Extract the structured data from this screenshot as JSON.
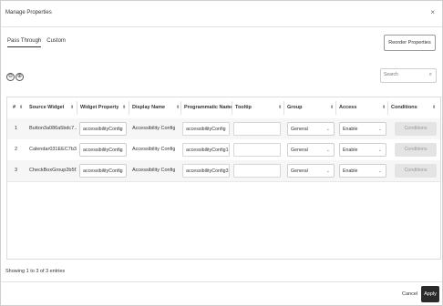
{
  "dialog": {
    "title": "Manage Properties",
    "close_icon": "×"
  },
  "tabs": [
    {
      "label": "Pass Through",
      "active": true
    },
    {
      "label": "Custom",
      "active": false
    }
  ],
  "toolbar": {
    "reorder_label": "Reorder Properties",
    "collapse_glyph": "⊖",
    "expand_glyph": "⊕"
  },
  "search": {
    "placeholder": "Search",
    "value": ""
  },
  "table": {
    "headers": {
      "index": "#",
      "source_widget": "Source Widget",
      "widget_property": "Widget Property",
      "display_name": "Display Name",
      "programmatic_name": "Programmatic Name",
      "tooltip": "Tooltip",
      "group": "Group",
      "access": "Access",
      "conditions": "Conditions"
    },
    "rows": [
      {
        "index": "1",
        "source_widget": "Button3a086a5bdc7...",
        "widget_property": "accessibilityConfig",
        "display_name": "Accessibility Config",
        "programmatic_name": "accessibilityConfig",
        "tooltip": "",
        "group": "General",
        "access": "Enable",
        "conditions": "Conditions"
      },
      {
        "index": "2",
        "source_widget": "Calendar031EEC7b3...",
        "widget_property": "accessibilityConfig",
        "display_name": "Accessibility Config",
        "programmatic_name": "accessibilityConfig1",
        "tooltip": "",
        "group": "General",
        "access": "Enable",
        "conditions": "Conditions"
      },
      {
        "index": "3",
        "source_widget": "CheckBoxGroup2b5f1...",
        "widget_property": "accessibilityConfig",
        "display_name": "Accessibility Config",
        "programmatic_name": "accessibilityConfig3",
        "tooltip": "",
        "group": "General",
        "access": "Enable",
        "conditions": "Conditions"
      }
    ]
  },
  "footer": {
    "summary": "Showing 1 to 3 of 3 entries",
    "cancel_label": "Cancel",
    "apply_label": "Apply"
  },
  "icons": {
    "sort": "⬍",
    "chevron": "⌄",
    "search": "⌕"
  },
  "colors": {
    "apply_bg": "#2a2a2a",
    "row_alt": "#f6f6f6",
    "disabled_btn": "#e4e4e4"
  }
}
